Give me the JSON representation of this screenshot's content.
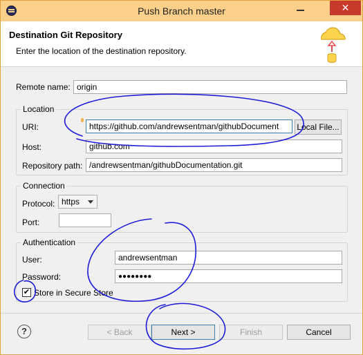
{
  "window": {
    "title": "Push Branch master",
    "close_glyph": "✕"
  },
  "banner": {
    "title": "Destination Git Repository",
    "description": "Enter the location of the destination repository.",
    "icon": "cloud-upload-icon"
  },
  "remote": {
    "label": "Remote name:",
    "value": "origin"
  },
  "location": {
    "group_label": "Location",
    "uri_label": "URI:",
    "uri_value": "https://github.com/andrewsentman/githubDocument",
    "local_file_button": "Local File...",
    "host_label": "Host:",
    "host_value": "github.com",
    "path_label": "Repository path:",
    "path_value": "/andrewsentman/githubDocumentation.git"
  },
  "connection": {
    "group_label": "Connection",
    "protocol_label": "Protocol:",
    "protocol_value": "https",
    "port_label": "Port:",
    "port_value": ""
  },
  "authentication": {
    "group_label": "Authentication",
    "user_label": "User:",
    "user_value": "andrewsentman",
    "password_label": "Password:",
    "password_value": "●●●●●●●●",
    "store_label": "Store in Secure Store",
    "store_checked": true,
    "check_glyph": "✔"
  },
  "footer": {
    "help_glyph": "?",
    "back_label": "< Back",
    "next_label": "Next >",
    "finish_label": "Finish",
    "cancel_label": "Cancel"
  },
  "colors": {
    "title_bar": "#fbd08a",
    "annotation_ink": "#1c1cd8",
    "close_button": "#c7392b"
  }
}
